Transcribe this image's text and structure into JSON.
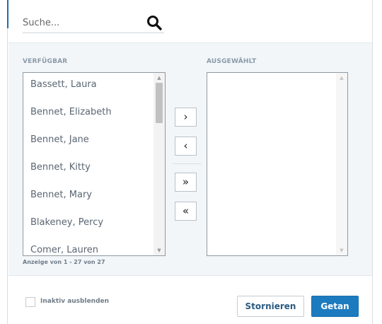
{
  "search": {
    "placeholder": "Suche...",
    "value": ""
  },
  "available": {
    "label": "VERFÜGBAR",
    "items": [
      "Bassett, Laura",
      "Bennet, Elizabeth",
      "Bennet, Jane",
      "Bennet, Kitty",
      "Bennet, Mary",
      "Blakeney, Percy",
      "Comer, Lauren"
    ],
    "count_text": "Anzeige von 1 - 27 von 27"
  },
  "selected": {
    "label": "AUSGEWÄHLT",
    "items": []
  },
  "move_buttons": {
    "add": "›",
    "remove": "‹",
    "add_all": "»",
    "remove_all": "«"
  },
  "footer": {
    "hide_inactive_label": "Inaktiv ausblenden",
    "hide_inactive_checked": false,
    "cancel_label": "Stornieren",
    "done_label": "Getan"
  },
  "colors": {
    "accent": "#1c7bbf",
    "panel_bg": "#f2f6f9",
    "label_gray": "#8a9aa8"
  },
  "icons": {
    "search": "search-icon",
    "scroll_up": "triangle-up-icon",
    "scroll_down": "triangle-down-icon"
  }
}
